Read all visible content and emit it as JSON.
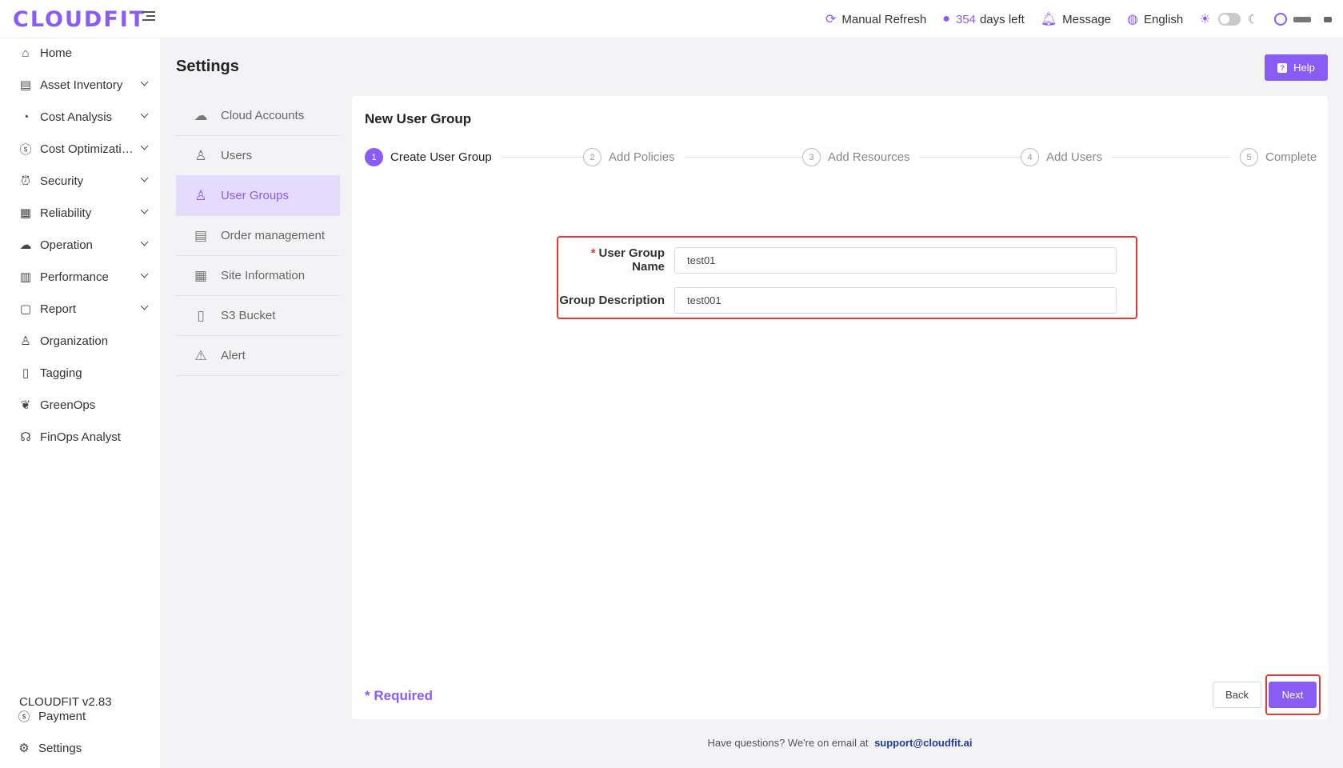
{
  "app": {
    "logo": "CLOUDFIT",
    "version": "CLOUDFIT v2.83"
  },
  "topbar": {
    "refresh_label": "Manual Refresh",
    "days_count": "354",
    "days_suffix": "days left",
    "message_label": "Message",
    "language_label": "English",
    "icons": [
      "refresh-icon",
      "clock-icon",
      "bell-icon",
      "globe-icon",
      "sun-icon",
      "moon-icon",
      "user-icon"
    ]
  },
  "sidebar": {
    "items": [
      {
        "label": "Home",
        "icon": "home-icon",
        "has_chevron": false
      },
      {
        "label": "Asset Inventory",
        "icon": "asset-icon",
        "has_chevron": true
      },
      {
        "label": "Cost Analysis",
        "icon": "gauge-icon",
        "has_chevron": true
      },
      {
        "label": "Cost Optimizati…",
        "icon": "dollar-icon",
        "has_chevron": true
      },
      {
        "label": "Security",
        "icon": "alarm-icon",
        "has_chevron": true
      },
      {
        "label": "Reliability",
        "icon": "document-check-icon",
        "has_chevron": true
      },
      {
        "label": "Operation",
        "icon": "cloud-cog-icon",
        "has_chevron": true
      },
      {
        "label": "Performance",
        "icon": "board-icon",
        "has_chevron": true
      },
      {
        "label": "Report",
        "icon": "report-icon",
        "has_chevron": true
      },
      {
        "label": "Organization",
        "icon": "org-chart-icon",
        "has_chevron": false
      },
      {
        "label": "Tagging",
        "icon": "tag-icon",
        "has_chevron": false
      },
      {
        "label": "GreenOps",
        "icon": "leaf-icon",
        "has_chevron": false
      },
      {
        "label": "FinOps Analyst",
        "icon": "brain-icon",
        "has_chevron": false
      }
    ],
    "bottom_items": [
      {
        "label": "Payment",
        "icon": "dollar-icon"
      },
      {
        "label": "Settings",
        "icon": "gear-icon"
      }
    ]
  },
  "page": {
    "title": "Settings",
    "help_label": "Help"
  },
  "settings_menu": {
    "items": [
      {
        "label": "Cloud Accounts",
        "icon": "cloud-icon",
        "active": false
      },
      {
        "label": "Users",
        "icon": "user-icon",
        "active": false
      },
      {
        "label": "User Groups",
        "icon": "user-group-icon",
        "active": true
      },
      {
        "label": "Order management",
        "icon": "clipboard-icon",
        "active": false
      },
      {
        "label": "Site Information",
        "icon": "site-info-icon",
        "active": false
      },
      {
        "label": "S3 Bucket",
        "icon": "bucket-icon",
        "active": false
      },
      {
        "label": "Alert",
        "icon": "warning-icon",
        "active": false
      }
    ]
  },
  "card": {
    "title": "New User Group",
    "steps": [
      {
        "num": "1",
        "label": "Create User Group",
        "active": true
      },
      {
        "num": "2",
        "label": "Add Policies",
        "active": false
      },
      {
        "num": "3",
        "label": "Add Resources",
        "active": false
      },
      {
        "num": "4",
        "label": "Add Users",
        "active": false
      },
      {
        "num": "5",
        "label": "Complete",
        "active": false
      }
    ],
    "form": {
      "name_label": "User Group Name",
      "name_required_mark": "*",
      "name_value": "test01",
      "desc_label": "Group Description",
      "desc_value": "test001"
    },
    "required_note": "* Required",
    "back_label": "Back",
    "next_label": "Next"
  },
  "footer": {
    "text": "Have questions? We're on email at",
    "email": "support@cloudfit.ai"
  },
  "colors": {
    "accent": "#8a5cf6",
    "highlight": "#e53935",
    "active_bg": "#e5dcfd"
  }
}
